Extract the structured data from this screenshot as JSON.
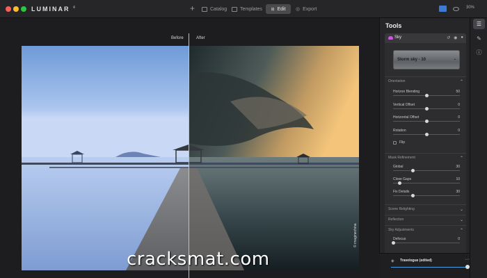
{
  "app": {
    "name": "LUMINAR",
    "version": "4"
  },
  "nav": {
    "add": "+",
    "catalog": "Catalog",
    "templates": "Templates",
    "edit": "Edit",
    "export": "Export",
    "zoom": "30%"
  },
  "canvas": {
    "before_label": "Before",
    "after_label": "After",
    "credit": "© imaginechina",
    "watermark": "cracksmat.com",
    "close_icon": "✕",
    "heart_icon": "♡"
  },
  "tools": {
    "title": "Tools",
    "sky": {
      "label": "Sky",
      "preset": "Storm sky - 10",
      "sections": [
        {
          "label": "Orientation",
          "expanded": true
        },
        {
          "label": "Mask Refinement",
          "expanded": true
        },
        {
          "label": "Scene Relighting",
          "expanded": false
        },
        {
          "label": "Reflection",
          "expanded": false
        },
        {
          "label": "Sky Adjustments",
          "expanded": true
        }
      ],
      "orientation": [
        {
          "name": "Horizon Blending",
          "value": "50",
          "fraction": 0.5
        },
        {
          "name": "Vertical Offset",
          "value": "0",
          "fraction": 0.5
        },
        {
          "name": "Horizontal Offset",
          "value": "0",
          "fraction": 0.5
        },
        {
          "name": "Rotation",
          "value": "0",
          "fraction": 0.5
        }
      ],
      "flip": "Flip",
      "mask": [
        {
          "name": "Global",
          "value": "30",
          "fraction": 0.3
        },
        {
          "name": "Close Gaps",
          "value": "10",
          "fraction": 0.1
        },
        {
          "name": "Fix Details",
          "value": "30",
          "fraction": 0.3
        }
      ],
      "sky_adjustments": [
        {
          "name": "Defocus",
          "value": "0",
          "fraction": 0.0
        }
      ]
    }
  },
  "footer": {
    "template": "Travelogue (edited)",
    "more": "···",
    "amount": 1.0
  },
  "colors": {
    "accent": "#4aa0e6",
    "split_line": "#8fd0ec",
    "sky_icon": "#c55ad8"
  }
}
